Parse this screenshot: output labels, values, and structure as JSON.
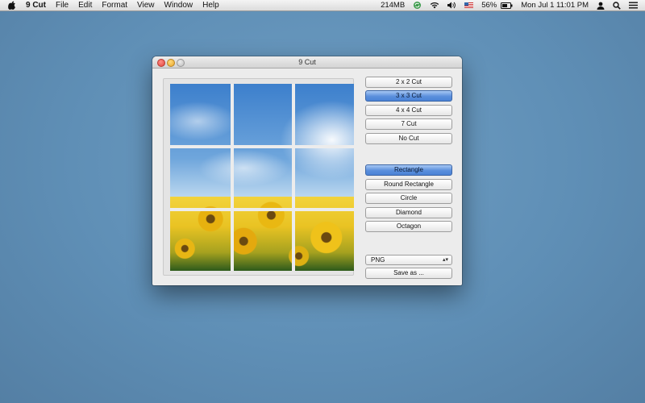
{
  "menubar": {
    "app_name": "9 Cut",
    "menus": [
      "File",
      "Edit",
      "Format",
      "View",
      "Window",
      "Help"
    ],
    "status": {
      "memory": "214MB",
      "battery": "56%",
      "datetime": "Mon Jul 1  11:01 PM"
    }
  },
  "window": {
    "title": "9 Cut"
  },
  "cut_buttons": [
    {
      "label": "2 x 2 Cut",
      "selected": false
    },
    {
      "label": "3 x 3 Cut",
      "selected": true
    },
    {
      "label": "4 x 4 Cut",
      "selected": false
    },
    {
      "label": "7 Cut",
      "selected": false
    },
    {
      "label": "No Cut",
      "selected": false
    }
  ],
  "shape_buttons": [
    {
      "label": "Rectangle",
      "selected": true
    },
    {
      "label": "Round Rectangle",
      "selected": false
    },
    {
      "label": "Circle",
      "selected": false
    },
    {
      "label": "Diamond",
      "selected": false
    },
    {
      "label": "Octagon",
      "selected": false
    }
  ],
  "format_select": {
    "value": "PNG"
  },
  "save_button": {
    "label": "Save as ..."
  },
  "colors": {
    "desktop": "#6395bc",
    "selected_button": "#5a8fdc"
  }
}
